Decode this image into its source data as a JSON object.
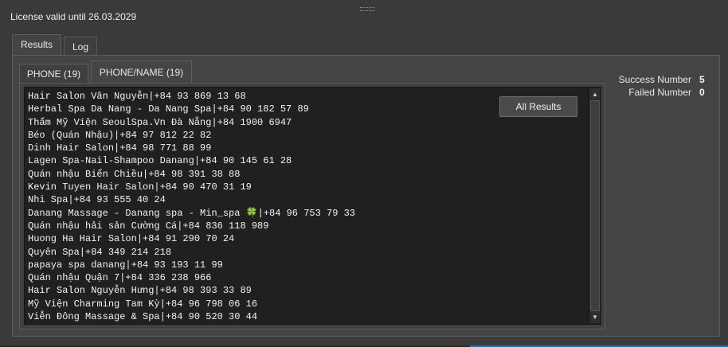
{
  "license_text": "License valid until 26.03.2029",
  "outer_tabs": [
    {
      "label": "Results",
      "active": true
    },
    {
      "label": "Log",
      "active": false
    }
  ],
  "inner_tabs": [
    {
      "label": "PHONE (19)",
      "active": false
    },
    {
      "label": "PHONE/NAME (19)",
      "active": true
    }
  ],
  "results": [
    "Hair Salon Vân Nguyễn|+84 93 869 13 68",
    "Herbal Spa Da Nang - Da Nang Spa|+84 90 182 57 89",
    "Thẩm Mỹ Viện SeoulSpa.Vn Đà Nẵng|+84 1900 6947",
    "Béo (Quán Nhậu)|+84 97 812 22 82",
    "Dinh Hair Salon|+84 98 771 88 99",
    "Lagen Spa-Nail-Shampoo Danang|+84 90 145 61 28",
    "Quán nhậu Biển Chiều|+84 98 391 38 88",
    "Kevin Tuyen Hair Salon|+84 90 470 31 19",
    "Nhi Spa|+84 93 555 40 24",
    "Danang Massage - Danang spa - Min_spa 🍀|+84 96 753 79 33",
    "Quán nhậu hải sản Cường Cá|+84 836 118 989",
    "Huong Ha Hair Salon|+84 91 290 70 24",
    "Quyên Spa|+84 349 214 218",
    "papaya spa danang|+84 93 193 11 99",
    "Quán nhậu Quận 7|+84 336 238 966",
    "Hair Salon Nguyễn Hưng|+84 98 393 33 89",
    "Mỹ Viện Charming Tam Kỳ|+84 96 798 06 16",
    "Viễn Đông Massage & Spa|+84 90 520 30 44"
  ],
  "all_results_label": "All Results",
  "stats": {
    "success_label": "Success Number",
    "success_value": "5",
    "failed_label": "Failed Number",
    "failed_value": "0"
  },
  "icons": {
    "scroll_up": "scroll-up-arrow-icon",
    "scroll_down": "scroll-down-arrow-icon",
    "drag_handle": "drag-handle-icon"
  }
}
